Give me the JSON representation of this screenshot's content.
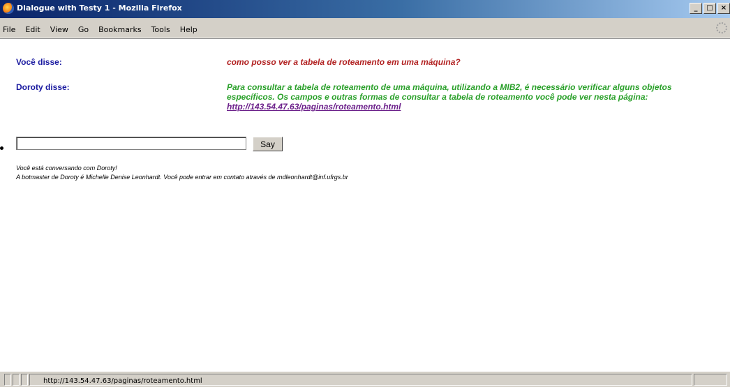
{
  "window": {
    "title": "Dialogue with Testy 1 - Mozilla Firefox",
    "buttons": [
      "_",
      "□",
      "×"
    ]
  },
  "menubar": {
    "items": [
      {
        "label": "File",
        "accel": "F"
      },
      {
        "label": "Edit",
        "accel": "E"
      },
      {
        "label": "View",
        "accel": "V"
      },
      {
        "label": "Go",
        "accel": "G"
      },
      {
        "label": "Bookmarks",
        "accel": "B"
      },
      {
        "label": "Tools",
        "accel": "T"
      },
      {
        "label": "Help",
        "accel": "H"
      }
    ]
  },
  "dialogue": {
    "user_label": "Você disse:",
    "user_message": "como posso ver a tabela de roteamento em uma máquina?",
    "bot_label": "Doroty disse:",
    "bot_message": "Para consultar a tabela de roteamento de uma máquina, utilizando a MIB2, é necessário verificar alguns objetos específicos. Os campos e outras formas de consultar a tabela de roteamento você pode ver nesta página: ",
    "bot_link": "http://143.54.47.63/paginas/roteamento.html"
  },
  "form": {
    "input_value": "",
    "say_label": "Say"
  },
  "footer": {
    "line1": "Você está conversando com Doroty!",
    "line2": "A botmaster de Doroty é Michelle Denise Leonhardt. Você pode entrar em contato através de mdleonhardt@inf.ufrgs.br"
  },
  "statusbar": {
    "text": "http://143.54.47.63/paginas/roteamento.html"
  },
  "colors": {
    "user_label": "#1a1aa0",
    "user_message": "#b22222",
    "bot_message": "#2aa02a",
    "link": "#6b1f8a"
  }
}
